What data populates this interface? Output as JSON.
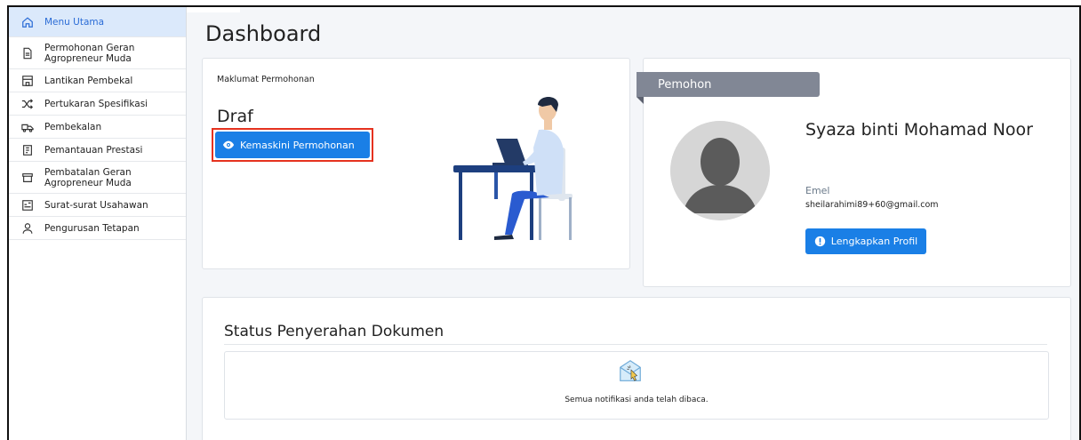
{
  "sidebar": {
    "items": [
      {
        "label": "Menu Utama",
        "icon": "home-icon",
        "active": true
      },
      {
        "label": "Permohonan Geran Agropreneur Muda",
        "icon": "document-icon"
      },
      {
        "label": "Lantikan Pembekal",
        "icon": "store-icon"
      },
      {
        "label": "Pertukaran Spesifikasi",
        "icon": "shuffle-icon"
      },
      {
        "label": "Pembekalan",
        "icon": "delivery-icon"
      },
      {
        "label": "Pemantauan Prestasi",
        "icon": "clipboard-icon"
      },
      {
        "label": "Pembatalan Geran Agropreneur Muda",
        "icon": "archive-icon"
      },
      {
        "label": "Surat-surat Usahawan",
        "icon": "letter-icon"
      },
      {
        "label": "Pengurusan Tetapan",
        "icon": "user-icon"
      }
    ]
  },
  "main": {
    "title": "Dashboard",
    "application": {
      "label": "Maklumat Permohonan",
      "status": "Draf",
      "update_button": "Kemaskini Permohonan"
    },
    "applicant": {
      "header": "Pemohon",
      "name": "Syaza binti Mohamad Noor",
      "email_label": "Emel",
      "email": "sheilarahimi89+60@gmail.com",
      "complete_button": "Lengkapkan Profil"
    },
    "documents": {
      "title": "Status Penyerahan Dokumen",
      "empty_message": "Semua notifikasi anda telah dibaca."
    }
  },
  "colors": {
    "accent": "#1a7fe6",
    "active_bg": "#dbe9fb",
    "active_text": "#2b6cd6",
    "tag_bg": "#818795",
    "highlight": "#e5321f"
  }
}
